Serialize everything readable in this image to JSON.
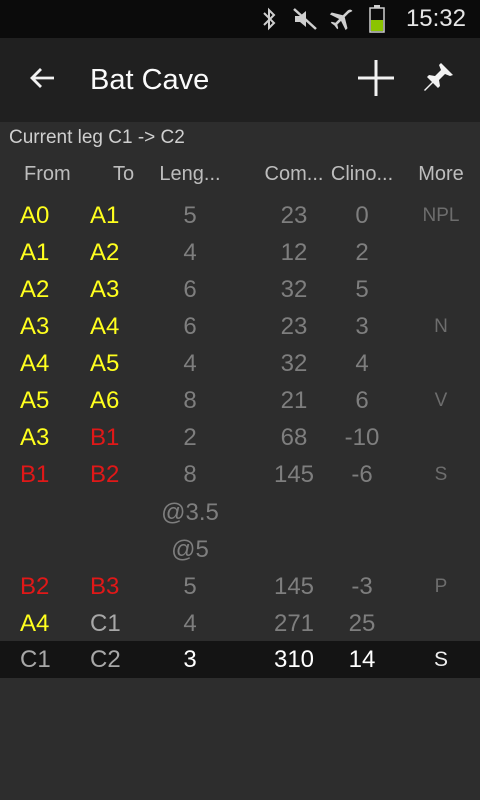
{
  "status_bar": {
    "time": "15:32",
    "icons": [
      "bluetooth-icon",
      "mute-icon",
      "airplane-icon",
      "battery-icon"
    ],
    "battery_color": "#8bc400"
  },
  "action_bar": {
    "title": "Bat Cave",
    "back_icon": "back-arrow-icon",
    "add_icon": "plus-icon",
    "pin_icon": "pin-icon"
  },
  "current_leg": "Current leg C1 -> C2",
  "headers": {
    "from": "From",
    "to": "To",
    "length": "Leng...",
    "compass": "Com...",
    "clino": "Clino...",
    "more": "More"
  },
  "colors": {
    "yellow": "#ffff1e",
    "red": "#e01818",
    "gray": "#a8a8a8"
  },
  "rows": [
    {
      "from": "A0",
      "to": "A1",
      "len": "5",
      "com": "23",
      "cli": "0",
      "more": "NPL",
      "from_color": "yellow",
      "to_color": "yellow"
    },
    {
      "from": "A1",
      "to": "A2",
      "len": "4",
      "com": "12",
      "cli": "2",
      "more": "",
      "from_color": "yellow",
      "to_color": "yellow"
    },
    {
      "from": "A2",
      "to": "A3",
      "len": "6",
      "com": "32",
      "cli": "5",
      "more": "",
      "from_color": "yellow",
      "to_color": "yellow"
    },
    {
      "from": "A3",
      "to": "A4",
      "len": "6",
      "com": "23",
      "cli": "3",
      "more": "N",
      "from_color": "yellow",
      "to_color": "yellow"
    },
    {
      "from": "A4",
      "to": "A5",
      "len": "4",
      "com": "32",
      "cli": "4",
      "more": "",
      "from_color": "yellow",
      "to_color": "yellow"
    },
    {
      "from": "A5",
      "to": "A6",
      "len": "8",
      "com": "21",
      "cli": "6",
      "more": "V",
      "from_color": "yellow",
      "to_color": "yellow"
    },
    {
      "from": "A3",
      "to": "B1",
      "len": "2",
      "com": "68",
      "cli": "-10",
      "more": "",
      "from_color": "yellow",
      "to_color": "red"
    },
    {
      "from": "B1",
      "to": "B2",
      "len": "8",
      "com": "145",
      "cli": "-6",
      "more": "S",
      "from_color": "red",
      "to_color": "red"
    },
    {
      "from": "",
      "to": "",
      "len": "@3.5",
      "com": "",
      "cli": "",
      "more": "",
      "from_color": "gray",
      "to_color": "gray"
    },
    {
      "from": "",
      "to": "",
      "len": "@5",
      "com": "",
      "cli": "",
      "more": "",
      "from_color": "gray",
      "to_color": "gray"
    },
    {
      "from": "B2",
      "to": "B3",
      "len": "5",
      "com": "145",
      "cli": "-3",
      "more": "P",
      "from_color": "red",
      "to_color": "red"
    },
    {
      "from": "A4",
      "to": "C1",
      "len": "4",
      "com": "271",
      "cli": "25",
      "more": "",
      "from_color": "yellow",
      "to_color": "gray"
    },
    {
      "from": "C1",
      "to": "C2",
      "len": "3",
      "com": "310",
      "cli": "14",
      "more": "S",
      "from_color": "gray",
      "to_color": "gray",
      "selected": true
    }
  ]
}
